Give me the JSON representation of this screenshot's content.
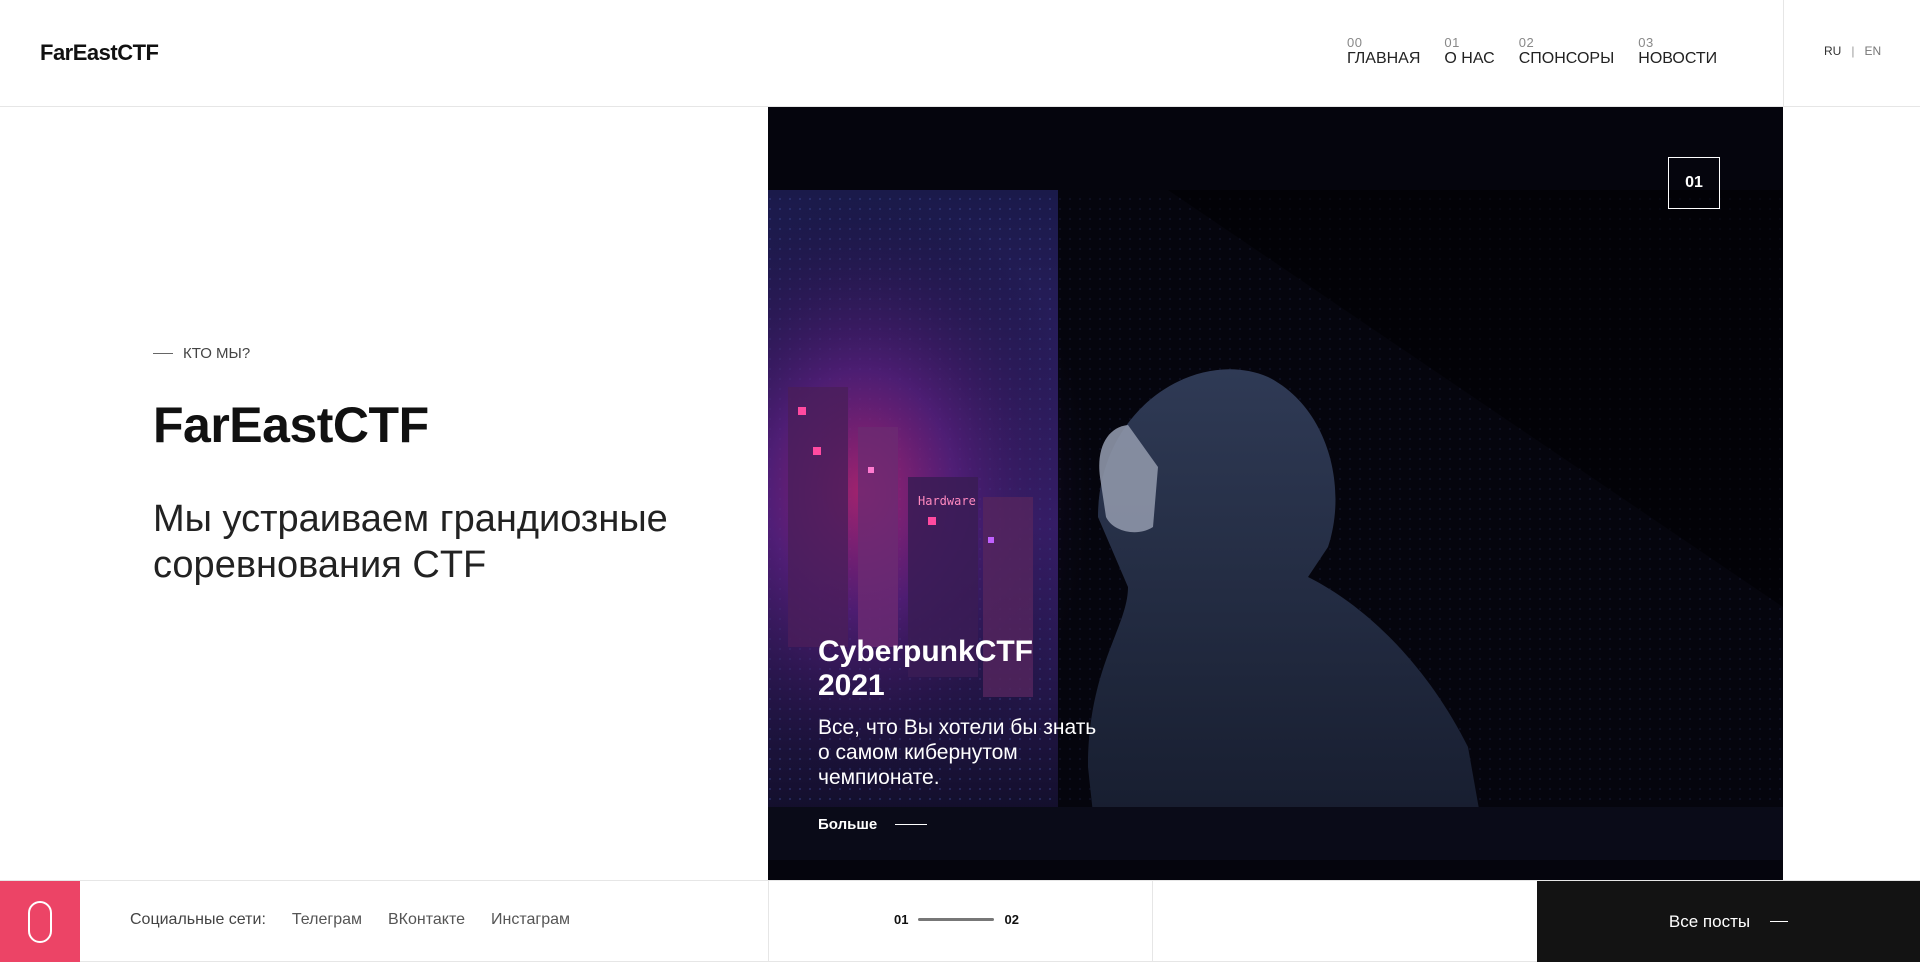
{
  "header": {
    "logo": "FarEastCTF",
    "nav": [
      {
        "num": "00",
        "label": "ГЛАВНАЯ"
      },
      {
        "num": "01",
        "label": "О НАС"
      },
      {
        "num": "02",
        "label": "СПОНСОРЫ"
      },
      {
        "num": "03",
        "label": "НОВОСТИ"
      }
    ],
    "lang": {
      "ru": "RU",
      "sep": "|",
      "en": "EN"
    }
  },
  "intro": {
    "kicker": "КТО МЫ?",
    "title": "FarEastCTF",
    "text": "Мы устраиваем грандиозные соревнования CTF"
  },
  "hero": {
    "slide_number": "01",
    "title": "CyberpunkCTF 2021",
    "description": "Все, что Вы хотели бы знать о самом кибернутом чемпионате.",
    "more_label": "Больше",
    "sign_text": "Hardware"
  },
  "footer": {
    "social_label": "Социальные сети:",
    "social_links": [
      "Телеграм",
      "ВКонтакте",
      "Инстаграм"
    ],
    "pager": {
      "current": "01",
      "total": "02"
    },
    "all_posts_label": "Все посты"
  },
  "colors": {
    "accent": "#ec4466",
    "dark": "#131313",
    "hero_bg": "#05050d"
  }
}
